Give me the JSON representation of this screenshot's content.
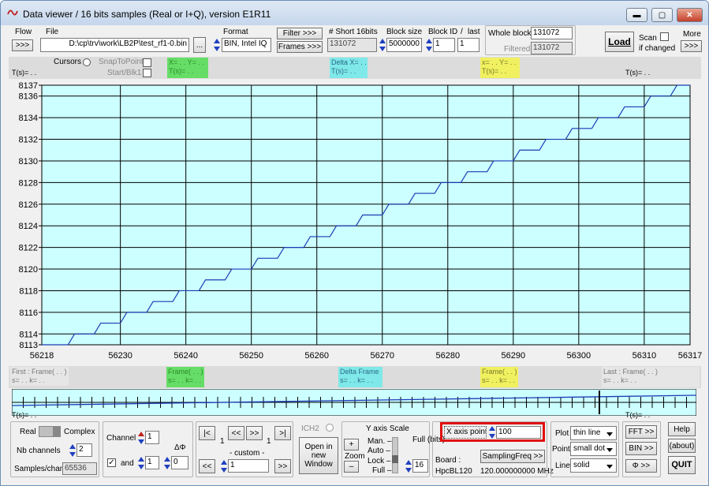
{
  "window": {
    "title": "Data viewer / 16 bits samples (Real or I+Q), version E1R11",
    "min_glyph": "▬",
    "max_glyph": "▢",
    "close_glyph": "✕"
  },
  "toolbar": {
    "flow_label": "Flow",
    "file_label": "File",
    "flow_button": ">>>",
    "file_path": "D:\\cp\\trv\\work\\LB2P\\test_rf1-0.bin",
    "browse_button": "...",
    "format_label": "Format",
    "format_value": "BIN, Intel IQ",
    "filter_button": "Filter >>>",
    "frames_button": "Frames >>>",
    "short16_label": "# Short 16bits",
    "short16_value": "131072",
    "block_size_label": "Block size",
    "block_size_value": "5000000",
    "block_id_label": "Block ID",
    "block_id_sep": "/",
    "last_label": "last",
    "block_id_value": "1",
    "last_value": "1",
    "whole_block_label": "Whole block",
    "whole_block_value": "131072",
    "filtered_label": "Filtered",
    "filtered_value": "131072",
    "load_button": "Load",
    "scan_label": "Scan",
    "if_changed_label": "if changed",
    "more_label": "More",
    "more_button": ">>>"
  },
  "cursors": {
    "cursors_label": "Cursors",
    "snap_label": "SnapToPoint",
    "start_label": "Start/Blk1",
    "t_left": "T(s)= . .",
    "c1_line1": "X= . . Y= . .",
    "c1_line2": "T(s)= . .",
    "delta_line1": "Delta X= . .",
    "delta_line2": "T(s)= . .",
    "c2_line1": "x= . . Y= . .",
    "c2_line2": "T(s)= . .",
    "t_right": "T(s)= . ."
  },
  "chart_data": {
    "type": "line",
    "xlim": [
      56218,
      56317
    ],
    "ylim": [
      8113,
      8137
    ],
    "x_ticks": [
      56218,
      56230,
      56240,
      56250,
      56260,
      56270,
      56280,
      56290,
      56300,
      56310,
      56317
    ],
    "y_ticks": [
      8137,
      8136,
      8134,
      8132,
      8130,
      8128,
      8126,
      8124,
      8122,
      8120,
      8118,
      8116,
      8114,
      8113
    ],
    "grid": true,
    "background": "#ccffff",
    "line_color": "#1a3bb5",
    "series": [
      {
        "values": [
          8113,
          8114,
          8115,
          8116,
          8117,
          8118,
          8119,
          8120,
          8121,
          8122,
          8123,
          8124,
          8125,
          8126,
          8127,
          8128,
          8129,
          8130,
          8131,
          8132,
          8133,
          8134,
          8135,
          8136,
          8137
        ]
      }
    ],
    "step_start_x": 56222,
    "step_period": 4
  },
  "frames": {
    "first_line1": "First : Frame( . . )",
    "first_line2": "s= . . k= . .",
    "f1_line1": "Frame( . . )",
    "f1_line2": "s= . . k= . .",
    "delta_line1": "Delta Frame",
    "delta_line2": "s= . . k= . .",
    "f2_line1": "Frame( . . )",
    "f2_line2": "s= . . k= . .",
    "last_line1": "Last : Frame( . . )",
    "last_line2": "s= . . k= . .",
    "t_left": "T(s)= . .",
    "t_right": "T(s)= . ."
  },
  "bottom": {
    "real_label": "Real",
    "complex_label": "Complex",
    "nb_channels_label": "Nb channels",
    "nb_channels_value": "2",
    "samples_label": "Samples/chan",
    "samples_value": "65536",
    "channel_label": "Channel",
    "channel_value": "1",
    "and_label": "and",
    "and_value": "1",
    "dphi_label": "ΔΦ",
    "dphi_value": "0",
    "nav_first": "|<",
    "nav_prev": "<<",
    "nav_next": ">>",
    "nav_last": ">|",
    "nav_sub": "1",
    "custom_label": "- custom -",
    "custom_value": "1",
    "nav_back": "<<",
    "nav_fwd": ">>",
    "ich2_label": "ICH2",
    "open_window_button": "Open in new Window",
    "yscale_label": "Y axis Scale",
    "man_label": "Man. –",
    "auto_label": "Auto –",
    "lock_label": "Lock –",
    "full_label": "Full –",
    "zoom_label": "Zoom",
    "zoom_plus": "+",
    "zoom_minus": "–",
    "fullbits_label": "Full (bits)",
    "fullbits_value": "16",
    "xpoints_label": "X axis points",
    "xpoints_value": "100",
    "sampling_button": "SamplingFreq >>",
    "board_label": "Board :",
    "board_value": "HpcBL120",
    "freq_value": "120.000000000 MHz",
    "plot_label": "Plot",
    "plot_value": "thin line",
    "point_label": "Point",
    "point_value": "small dot",
    "line_label": "Line",
    "line_value": "solid",
    "fft_button": "FFT >>",
    "bin_button": "BIN >>",
    "phi_button": "Φ >>",
    "help_button": "Help",
    "about_button": "(about)",
    "quit_button": "QUIT"
  },
  "colors": {
    "green": "#66dd66",
    "cyan": "#7fe8e8",
    "yellow": "#f0f060",
    "highlight_red": "#e01010"
  }
}
